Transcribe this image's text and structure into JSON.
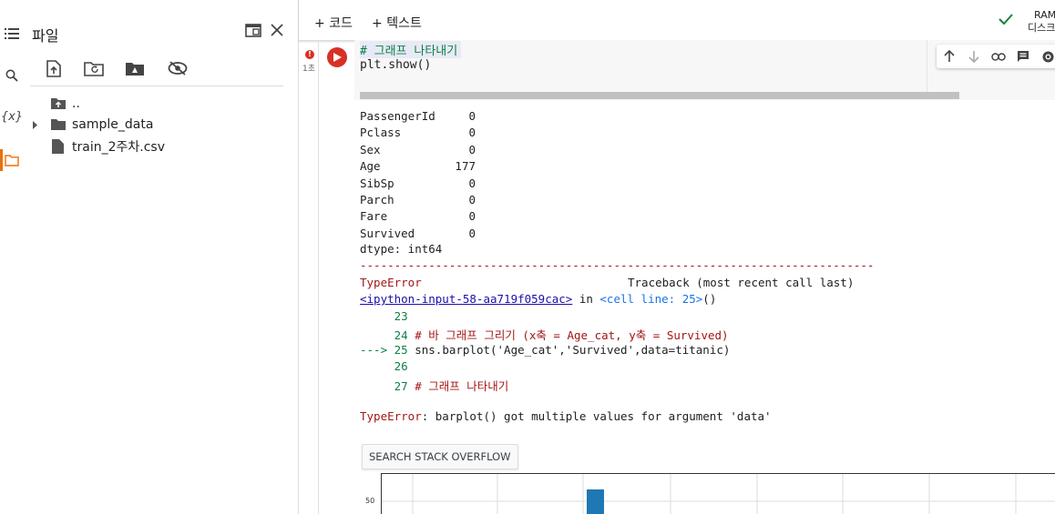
{
  "sidebar_rail": {
    "items": [
      {
        "name": "toc",
        "icon": "list-icon"
      },
      {
        "name": "search",
        "icon": "search-icon"
      },
      {
        "name": "variables",
        "icon": "variables-icon",
        "label": "{x}"
      },
      {
        "name": "files",
        "icon": "folder-icon",
        "active": true
      }
    ]
  },
  "files_panel": {
    "title": "파일",
    "toolbar": [
      "upload-icon",
      "refresh-folder-icon",
      "drive-icon",
      "hide-icon"
    ],
    "tree": [
      {
        "label": "..",
        "type": "parent-folder"
      },
      {
        "label": "sample_data",
        "type": "folder",
        "expandable": true
      },
      {
        "label": "train_2주차.csv",
        "type": "file"
      }
    ]
  },
  "topbar": {
    "add_code": "코드",
    "add_text": "텍스트",
    "ram_label": "RAM",
    "disk_label": "디스크"
  },
  "cell": {
    "exec_time": "1초",
    "code_lines": [
      "# 그래프 나타내기",
      "plt.show()"
    ],
    "output_series": [
      {
        "name": "PassengerId",
        "value": "0"
      },
      {
        "name": "Pclass",
        "value": "0"
      },
      {
        "name": "Sex",
        "value": "0"
      },
      {
        "name": "Age",
        "value": "177"
      },
      {
        "name": "SibSp",
        "value": "0"
      },
      {
        "name": "Parch",
        "value": "0"
      },
      {
        "name": "Fare",
        "value": "0"
      },
      {
        "name": "Survived",
        "value": "0"
      }
    ],
    "dtype_line": "dtype: int64",
    "separator": "---------------------------------------------------------------------------",
    "error_type": "TypeError",
    "traceback_header": "Traceback (most recent call last)",
    "ipython_link": "<ipython-input-58-aa719f059cac>",
    "in_text": " in ",
    "cell_line": "<cell line: 25>",
    "cell_paren": "()",
    "tb_lines": [
      {
        "prefix": "     ",
        "num": "23",
        "text": ""
      },
      {
        "prefix": "     ",
        "num": "24",
        "text": " # 바 그래프 그리기 (x축 = Age_cat, y축 = Survived)"
      },
      {
        "prefix": "---> ",
        "num": "25",
        "text": " sns.barplot('Age_cat','Survived',data=titanic)"
      },
      {
        "prefix": "     ",
        "num": "26",
        "text": ""
      },
      {
        "prefix": "     ",
        "num": "27",
        "text": " # 그래프 나타내기"
      }
    ],
    "error_message_type": "TypeError",
    "error_message": ": barplot() got multiple values for argument 'data'",
    "search_button": "SEARCH STACK OVERFLOW",
    "plot_ytick": "50"
  },
  "colors": {
    "error_red": "#a31515",
    "link_blue": "#1a0dab",
    "run_red": "#d93025",
    "accent_orange": "#e8710a",
    "code_green": "#0b8043",
    "bar_blue": "#1f77b4"
  }
}
